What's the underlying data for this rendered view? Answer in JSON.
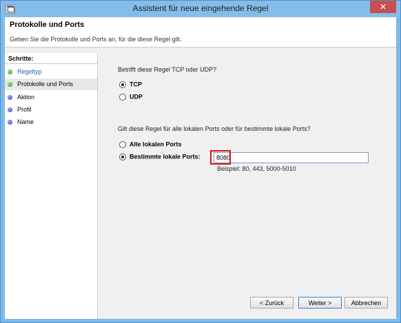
{
  "window": {
    "title": "Assistent für neue eingehende Regel",
    "close_glyph": "✕"
  },
  "header": {
    "title": "Protokolle und Ports",
    "description": "Geben Sie die Protokolle und Ports an, für die diese Regel gilt."
  },
  "sidebar": {
    "heading": "Schritte:",
    "steps": [
      {
        "label": "Regeltyp",
        "icon": "green-dot"
      },
      {
        "label": "Protokolle und Ports",
        "icon": "green-dot"
      },
      {
        "label": "Aktion",
        "icon": "blue-dot"
      },
      {
        "label": "Profil",
        "icon": "blue-dot"
      },
      {
        "label": "Name",
        "icon": "blue-dot"
      }
    ]
  },
  "protocol": {
    "question": "Betrifft diese Regel TCP oder UDP?",
    "options": [
      {
        "label": "TCP",
        "selected": true
      },
      {
        "label": "UDP",
        "selected": false
      }
    ]
  },
  "ports": {
    "question": "Gilt diese Regel für alle lokalen Ports oder für bestimmte lokale Ports?",
    "options": [
      {
        "label": "Alle lokalen Ports",
        "selected": false
      },
      {
        "label": "Bestimmte lokale Ports:",
        "selected": true
      }
    ],
    "value": "8080",
    "example": "Beispiel: 80, 443, 5000-5010"
  },
  "buttons": {
    "back": "< Zurück",
    "next": "Weiter >",
    "cancel": "Abbrechen"
  },
  "colors": {
    "titlebar": "#84bdea",
    "highlight": "#e01010",
    "step_done": "#1f5fa9"
  }
}
